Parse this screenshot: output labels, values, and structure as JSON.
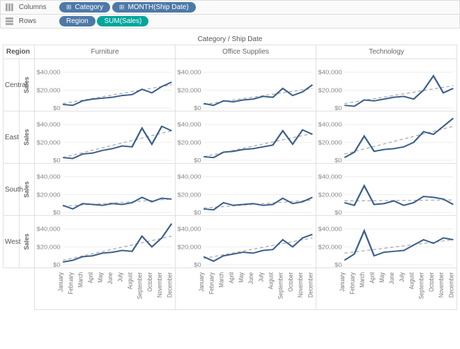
{
  "shelves": {
    "columns": {
      "label": "Columns",
      "pills": [
        {
          "label": "Category",
          "cls": "dim-blue",
          "icon": "⊞"
        },
        {
          "label": "MONTH(Ship Date)",
          "cls": "dim-blue",
          "icon": "⊞"
        }
      ]
    },
    "rows": {
      "label": "Rows",
      "pills": [
        {
          "label": "Region",
          "cls": "dim-blue",
          "icon": ""
        },
        {
          "label": "SUM(Sales)",
          "cls": "meas-green",
          "icon": ""
        }
      ]
    }
  },
  "viz_title": "Category / Ship Date",
  "row_header_title": "Region",
  "y_axis_label": "Sales",
  "y_ticks": [
    "$0",
    "$20,000",
    "$40,000"
  ],
  "chart_data": {
    "type": "line",
    "title": "Category / Ship Date",
    "ylabel": "Sales",
    "ylim": [
      0,
      50000
    ],
    "months": [
      "January",
      "February",
      "March",
      "April",
      "May",
      "June",
      "July",
      "August",
      "September",
      "October",
      "November",
      "December"
    ],
    "categories": [
      "Furniture",
      "Office Supplies",
      "Technology"
    ],
    "regions": [
      "Central",
      "East",
      "South",
      "West"
    ],
    "series": {
      "Central": {
        "Furniture": [
          4000,
          3000,
          8000,
          10000,
          11000,
          12000,
          14000,
          15000,
          21000,
          17000,
          24000,
          29000
        ],
        "Office Supplies": [
          5000,
          3000,
          8000,
          7000,
          9000,
          10000,
          13000,
          12000,
          22000,
          14000,
          18000,
          26000
        ],
        "Technology": [
          3000,
          2000,
          9000,
          8000,
          10000,
          12000,
          13000,
          10000,
          20000,
          36000,
          17000,
          22000
        ]
      },
      "East": {
        "Furniture": [
          3000,
          2000,
          7000,
          8000,
          11000,
          13000,
          16000,
          15000,
          36000,
          18000,
          38000,
          33000
        ],
        "Office Supplies": [
          4000,
          3000,
          9000,
          10000,
          12000,
          13000,
          15000,
          17000,
          33000,
          18000,
          34000,
          29000
        ],
        "Technology": [
          3000,
          9000,
          27000,
          10000,
          12000,
          13000,
          15000,
          20000,
          32000,
          29000,
          38000,
          47000
        ]
      },
      "South": {
        "Furniture": [
          8000,
          4000,
          10000,
          9000,
          8000,
          10000,
          9000,
          11000,
          17000,
          12000,
          16000,
          15000
        ],
        "Office Supplies": [
          4000,
          3000,
          11000,
          8000,
          9000,
          10000,
          8000,
          9000,
          16000,
          10000,
          12000,
          17000
        ],
        "Technology": [
          11000,
          8000,
          30000,
          9000,
          10000,
          13000,
          8000,
          11000,
          18000,
          17000,
          15000,
          9000
        ]
      },
      "West": {
        "Furniture": [
          3000,
          5000,
          9000,
          10000,
          13000,
          14000,
          16000,
          15000,
          32000,
          20000,
          30000,
          46000
        ],
        "Office Supplies": [
          9000,
          4000,
          10000,
          12000,
          14000,
          13000,
          16000,
          17000,
          28000,
          20000,
          30000,
          34000
        ],
        "Technology": [
          5000,
          12000,
          38000,
          10000,
          14000,
          15000,
          16000,
          22000,
          28000,
          24000,
          30000,
          28000
        ]
      }
    },
    "trend": {
      "Central": {
        "Furniture": [
          5000,
          26000
        ],
        "Office Supplies": [
          4000,
          22000
        ],
        "Technology": [
          5000,
          25000
        ]
      },
      "East": {
        "Furniture": [
          3000,
          33000
        ],
        "Office Supplies": [
          4000,
          30000
        ],
        "Technology": [
          7000,
          38000
        ]
      },
      "South": {
        "Furniture": [
          7000,
          15000
        ],
        "Office Supplies": [
          5000,
          14000
        ],
        "Technology": [
          13000,
          14000
        ]
      },
      "West": {
        "Furniture": [
          5000,
          32000
        ],
        "Office Supplies": [
          7000,
          30000
        ],
        "Technology": [
          13000,
          28000
        ]
      }
    }
  }
}
